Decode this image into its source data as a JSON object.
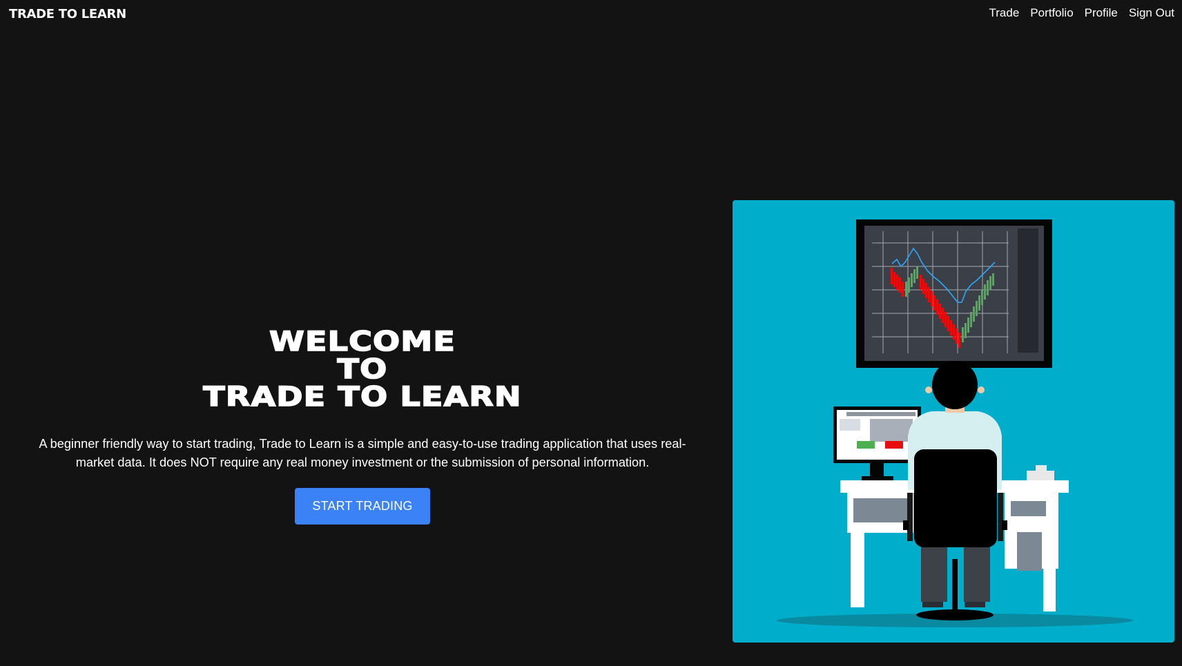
{
  "header": {
    "brand": "TRADE TO LEARN",
    "nav": [
      {
        "label": "Trade"
      },
      {
        "label": "Portfolio"
      },
      {
        "label": "Profile"
      },
      {
        "label": "Sign Out"
      }
    ]
  },
  "hero": {
    "title_lines": [
      "WELCOME",
      "TO",
      "TRADE TO LEARN"
    ],
    "description": "A beginner friendly way to start trading, Trade to Learn is a simple and easy-to-use trading application that uses real-market data. It does NOT require any real money investment or the submission of personal information.",
    "cta_label": "START TRADING"
  },
  "colors": {
    "background": "#131313",
    "accent": "#3b82f6",
    "illustration_bg": "#00aecb",
    "candle_up": "#4caf50",
    "candle_down": "#e80d0d"
  },
  "illustration": {
    "icon": "trader-at-desk-illustration"
  }
}
